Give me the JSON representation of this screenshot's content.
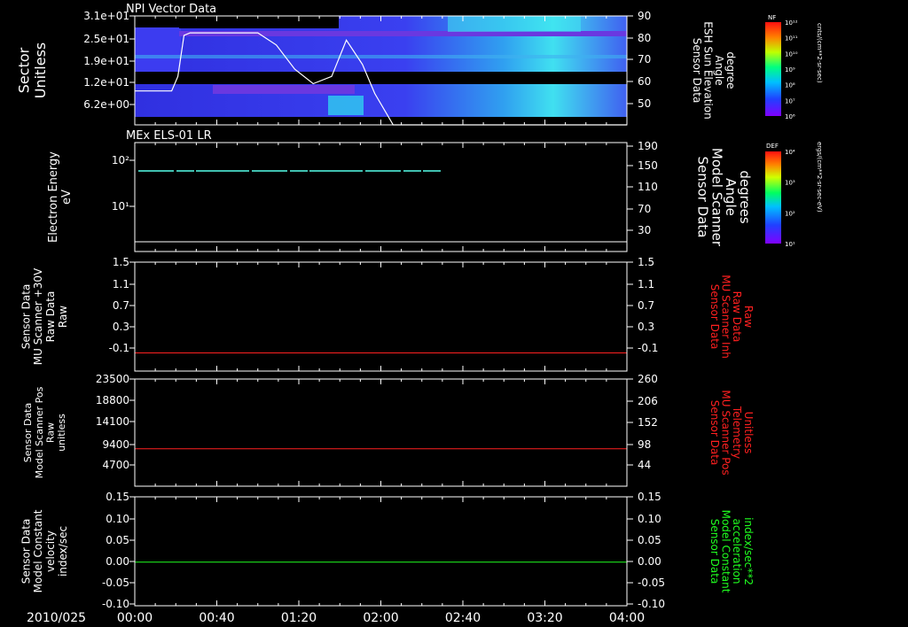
{
  "date_label": "2010/025",
  "time_ticks": [
    "00:00",
    "00:40",
    "01:20",
    "02:00",
    "02:40",
    "03:20",
    "04:00"
  ],
  "colors": {
    "background": "#000000",
    "axis": "#ffffff",
    "red_trace": "#ff2020",
    "green_trace": "#20ff20",
    "spectrogram_base": "#3a3ae0"
  },
  "panels": [
    {
      "id": "npi",
      "title": "NPI Vector Data",
      "left_label": [
        "Sector",
        "Unitless"
      ],
      "left_ticks": [
        "3.1e+01",
        "2.5e+01",
        "1.9e+01",
        "1.2e+01",
        "6.2e+00"
      ],
      "right_label": [
        "Sensor Data",
        "ESH Sun Elevation",
        "Angle",
        "degree"
      ],
      "right_ticks": [
        "90",
        "80",
        "70",
        "60",
        "50"
      ],
      "colorbar": {
        "top_label": "NF",
        "ticks": [
          "10¹²",
          "10¹¹",
          "10¹⁰",
          "10⁹",
          "10⁸",
          "10⁷",
          "10⁶"
        ],
        "unit": "cnts/(cm**2-sr-sec)"
      }
    },
    {
      "id": "els",
      "title": "MEx ELS-01 LR",
      "left_label": [
        "Electron Energy",
        "eV"
      ],
      "left_ticks": [
        "10²",
        "10¹"
      ],
      "right_label": [
        "Sensor Data",
        "Model Scanner",
        "Angle",
        "degrees"
      ],
      "right_ticks": [
        "190",
        "150",
        "110",
        "70",
        "30"
      ],
      "colorbar": {
        "top_label": "DEF",
        "ticks": [
          "10⁴",
          "10³",
          "10²",
          "10¹"
        ],
        "unit": "ergs/(cm**2-sr-sec-eV)"
      }
    },
    {
      "id": "mu_raw",
      "title": "",
      "left_label": [
        "Sensor Data",
        "MU Scanner +30V",
        "Raw Data",
        "Raw"
      ],
      "left_ticks": [
        "1.5",
        "1.1",
        "0.7",
        "0.3",
        "-0.1"
      ],
      "right_label": [
        "Sensor Data",
        "MU Scanner Inh",
        "Raw Data",
        "Raw"
      ],
      "right_ticks": [
        "1.5",
        "1.1",
        "0.7",
        "0.3",
        "-0.1"
      ],
      "right_label_color": "red"
    },
    {
      "id": "scanner_pos",
      "title": "",
      "left_label": [
        "Sensor Data",
        "Model Scanner Pos",
        "Raw",
        "unitless"
      ],
      "left_ticks": [
        "23500",
        "18800",
        "14100",
        "9400",
        "4700"
      ],
      "right_label": [
        "Sensor Data",
        "MU Scanner Pos",
        "Telemetry",
        "Unitless"
      ],
      "right_ticks": [
        "260",
        "206",
        "152",
        "98",
        "44"
      ],
      "right_label_color": "red"
    },
    {
      "id": "constant",
      "title": "",
      "left_label": [
        "Sensor Data",
        "Model Constant",
        "velocity",
        "index/sec"
      ],
      "left_ticks": [
        "0.15",
        "0.10",
        "0.05",
        "0.00",
        "-0.05",
        "-0.10"
      ],
      "right_label": [
        "Sensor Data",
        "Model Constant",
        "acceleration",
        "index/sec**2"
      ],
      "right_ticks": [
        "0.15",
        "0.10",
        "0.05",
        "0.00",
        "-0.05",
        "-0.10"
      ],
      "right_label_color": "green"
    }
  ],
  "chart_data": [
    {
      "type": "heatmap",
      "title": "NPI Vector Data",
      "xlabel": "",
      "ylabel": "Sector Unitless",
      "y2label": "Sensor Data ESH Sun Elevation Angle degree",
      "xlim": [
        "00:00",
        "04:00"
      ],
      "ylim": [
        0,
        31
      ],
      "y2lim": [
        45,
        90
      ],
      "overlay_series": {
        "name": "",
        "x_hours": [
          0,
          0.3,
          0.35,
          0.4,
          0.45,
          1.0,
          1.15,
          1.3,
          1.45,
          1.6,
          1.72,
          1.85,
          1.95,
          2.1,
          4.0
        ],
        "y": [
          59,
          59,
          65,
          82,
          83,
          83,
          78,
          68,
          62,
          65,
          80,
          70,
          58,
          45,
          45
        ]
      }
    },
    {
      "type": "heatmap",
      "title": "MEx ELS-01 LR",
      "ylabel": "Electron Energy eV",
      "y2label": "Sensor Data Model Scanner Angle degrees",
      "yscale": "log",
      "xlim": [
        "00:00",
        "04:00"
      ],
      "y2lim": [
        0,
        190
      ],
      "data_band": {
        "energy_eV": 55,
        "x_hours_start": 0.1,
        "x_hours_end": 2.6
      },
      "overlay_series": {
        "name": "",
        "x_hours": [
          0,
          4.0
        ],
        "y": [
          10,
          10
        ]
      }
    },
    {
      "type": "line",
      "ylabel": "Sensor Data MU Scanner +30V Raw Data Raw",
      "ylim": [
        -0.3,
        1.5
      ],
      "series": [
        {
          "name": "",
          "color": "red",
          "x_hours": [
            0,
            4.0
          ],
          "y": [
            -0.0,
            -0.0
          ]
        }
      ]
    },
    {
      "type": "line",
      "ylabel": "Sensor Data Model Scanner Pos Raw unitless",
      "ylim": [
        0,
        23500
      ],
      "series": [
        {
          "name": "",
          "color": "red",
          "x_hours": [
            0,
            4.0
          ],
          "y": [
            8200,
            8200
          ]
        }
      ]
    },
    {
      "type": "line",
      "ylabel": "Sensor Data Model Constant velocity index/sec",
      "ylim": [
        -0.1,
        0.15
      ],
      "series": [
        {
          "name": "",
          "color": "green",
          "x_hours": [
            0,
            4.0
          ],
          "y": [
            0.0,
            0.0
          ]
        }
      ]
    }
  ]
}
